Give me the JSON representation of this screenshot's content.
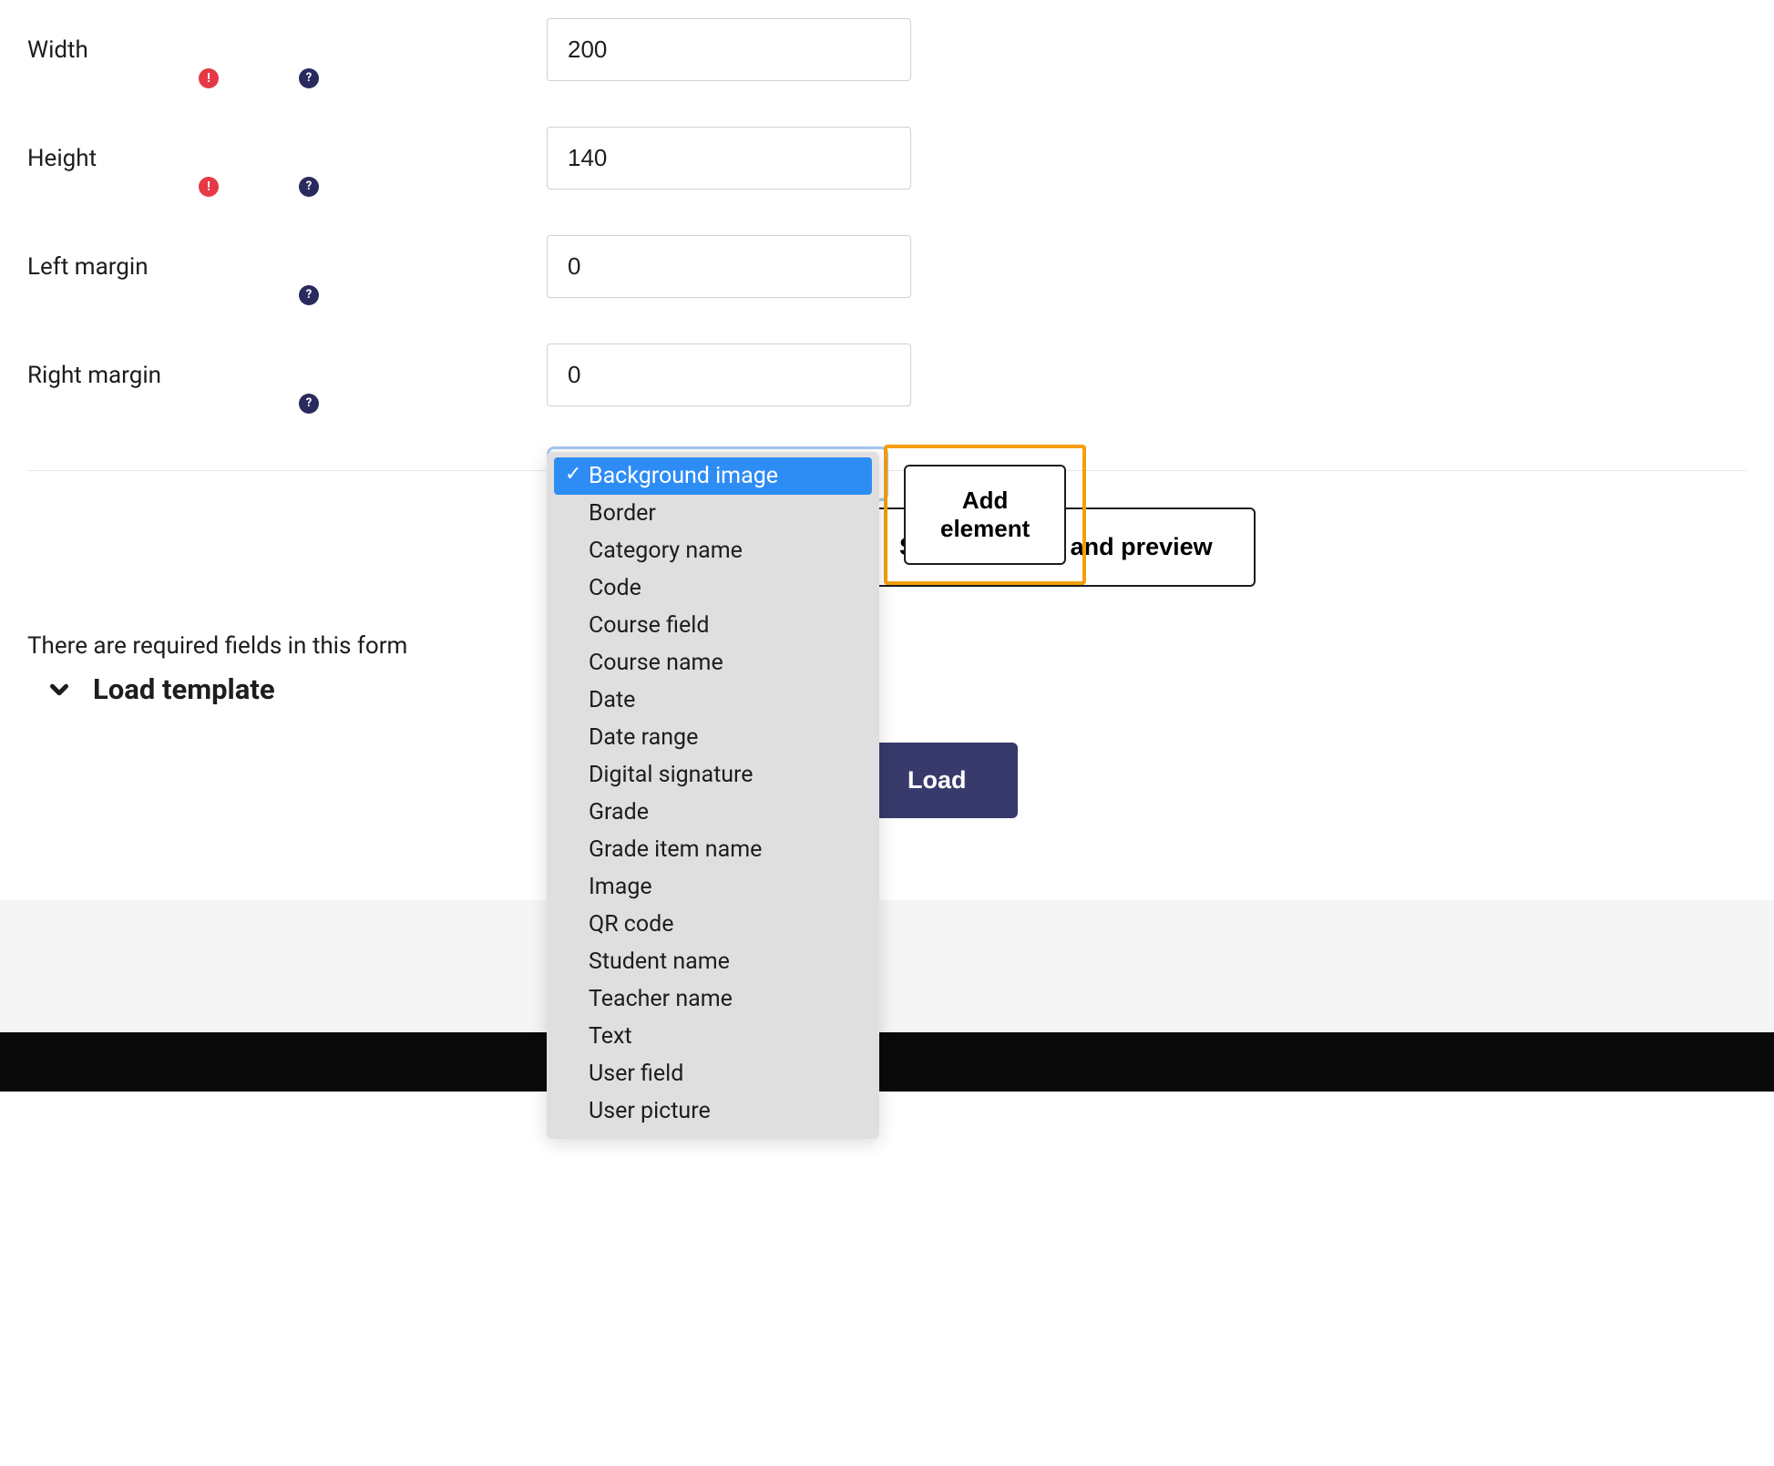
{
  "form": {
    "width": {
      "label": "Width",
      "value": "200"
    },
    "height": {
      "label": "Height",
      "value": "140"
    },
    "leftMargin": {
      "label": "Left margin",
      "value": "0"
    },
    "rightMargin": {
      "label": "Right margin",
      "value": "0"
    }
  },
  "dropdown": {
    "items": [
      "Background image",
      "Border",
      "Category name",
      "Code",
      "Course field",
      "Course name",
      "Date",
      "Date range",
      "Digital signature",
      "Grade",
      "Grade item name",
      "Image",
      "QR code",
      "Student name",
      "Teacher name",
      "Text",
      "User field",
      "User picture"
    ],
    "selectedIndex": 0
  },
  "buttons": {
    "addElement": "Add element",
    "savePreview": "Save changes and preview",
    "load": "Load"
  },
  "messages": {
    "requiredFields": "There are required fields in this form"
  },
  "sections": {
    "loadTemplate": "Load template"
  },
  "icons": {
    "required": "!",
    "help": "?"
  }
}
